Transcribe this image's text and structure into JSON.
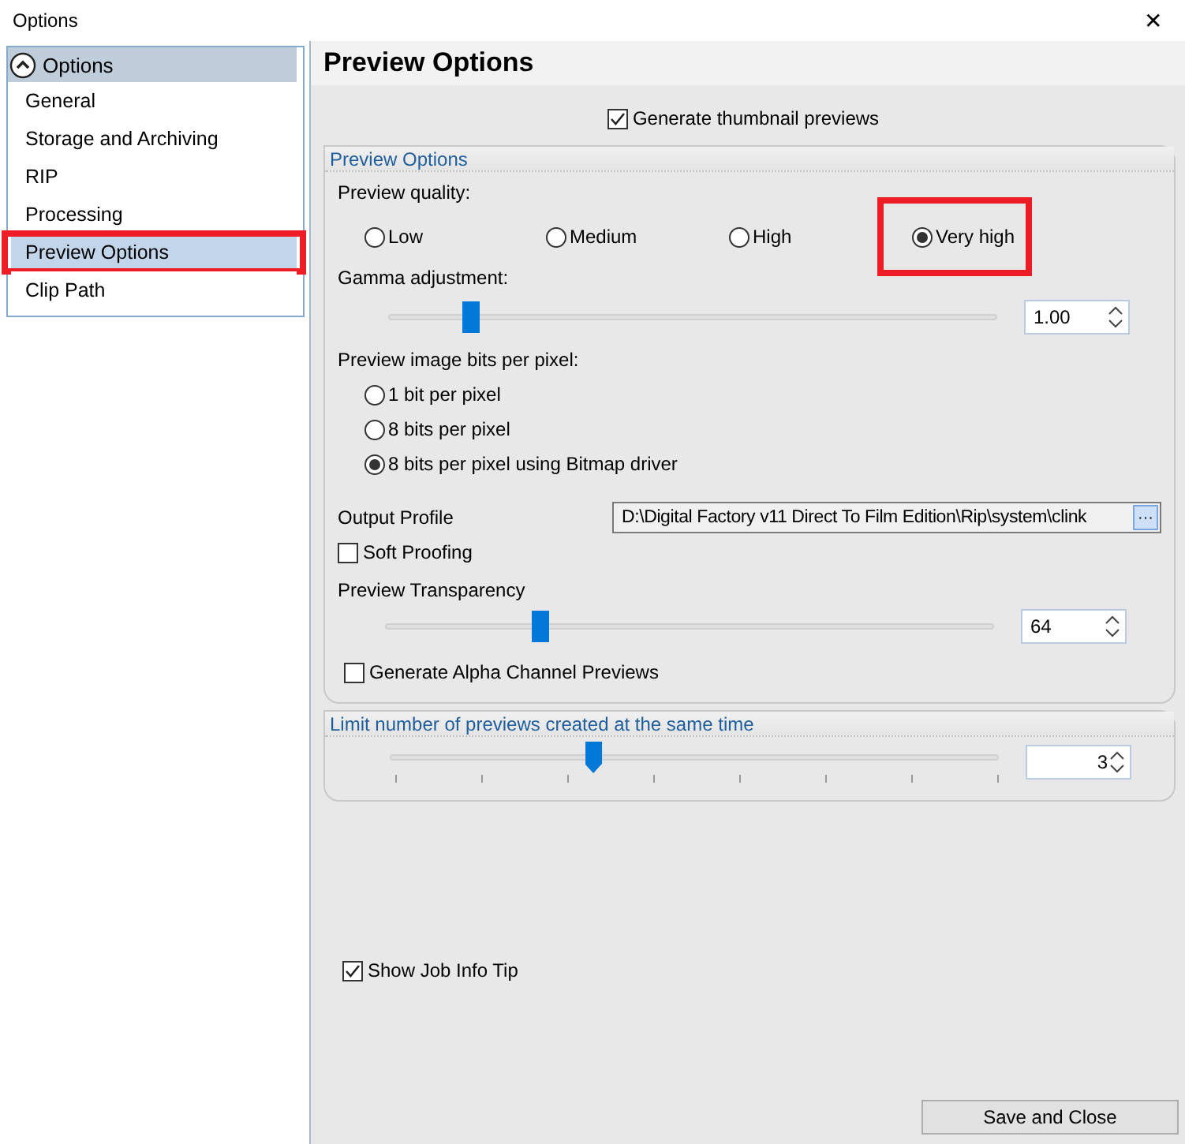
{
  "window": {
    "title": "Options",
    "close": "✕"
  },
  "sidebar": {
    "header": {
      "label": "Options",
      "expanded": true
    },
    "items": [
      {
        "label": "General",
        "selected": false,
        "highlighted": false
      },
      {
        "label": "Storage and Archiving",
        "selected": false,
        "highlighted": false
      },
      {
        "label": "RIP",
        "selected": false,
        "highlighted": false
      },
      {
        "label": "Processing",
        "selected": false,
        "highlighted": false
      },
      {
        "label": "Preview Options",
        "selected": true,
        "highlighted": true
      },
      {
        "label": "Clip Path",
        "selected": false,
        "highlighted": false
      }
    ]
  },
  "page_title": "Preview Options",
  "generate_thumbnails": {
    "label": "Generate thumbnail previews",
    "checked": true
  },
  "preview_group": {
    "title": "Preview Options",
    "quality": {
      "label": "Preview quality:",
      "options": [
        {
          "label": "Low",
          "selected": false,
          "highlighted": false
        },
        {
          "label": "Medium",
          "selected": false,
          "highlighted": false
        },
        {
          "label": "High",
          "selected": false,
          "highlighted": false
        },
        {
          "label": "Very high",
          "selected": true,
          "highlighted": true
        }
      ]
    },
    "gamma": {
      "label": "Gamma adjustment:",
      "level": 0.135,
      "value": "1.00"
    },
    "bits": {
      "label": "Preview image bits per pixel:",
      "options": [
        {
          "label": "1 bit per pixel",
          "selected": false
        },
        {
          "label": "8 bits per pixel",
          "selected": false
        },
        {
          "label": "8 bits per pixel using Bitmap driver",
          "selected": true
        }
      ]
    },
    "output_profile": {
      "label": "Output Profile",
      "value": "D:\\Digital Factory v11 Direct To Film Edition\\Rip\\system\\clink",
      "browse": "···"
    },
    "soft_proofing": {
      "label": "Soft Proofing",
      "checked": false
    },
    "transparency": {
      "label": "Preview Transparency",
      "level": 0.255,
      "value": "64"
    },
    "alpha": {
      "label": "Generate Alpha Channel Previews",
      "checked": false
    }
  },
  "limit_group": {
    "title": "Limit number of previews created at the same time",
    "level": 0.333,
    "value": "3"
  },
  "job_info_tip": {
    "label": "Show Job Info Tip",
    "checked": true
  },
  "save_button": "Save and Close"
}
